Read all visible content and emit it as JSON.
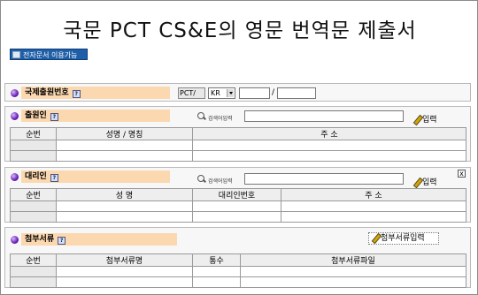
{
  "title": "국문 PCT CS&E의 영문 번역문 제출서",
  "badge": "전자문서 이용가능",
  "intl_app_no": {
    "label": "국제출원번호",
    "prefix": "PCT/",
    "country": "KR",
    "separator": "/"
  },
  "applicant": {
    "label": "출원인",
    "search_label": "검색어입력",
    "input_label": "입력",
    "columns": [
      "순번",
      "성명 / 명칭",
      "주          소"
    ]
  },
  "agent": {
    "label": "대리인",
    "search_label": "검색어입력",
    "input_label": "입력",
    "close": "x",
    "columns": [
      "순번",
      "성        명",
      "대리인번호",
      "주          소"
    ]
  },
  "attachments": {
    "label": "첨부서류",
    "button_label": "첨부서류입력",
    "columns": [
      "순번",
      "첨부서류명",
      "통수",
      "첨부서류파일"
    ]
  }
}
